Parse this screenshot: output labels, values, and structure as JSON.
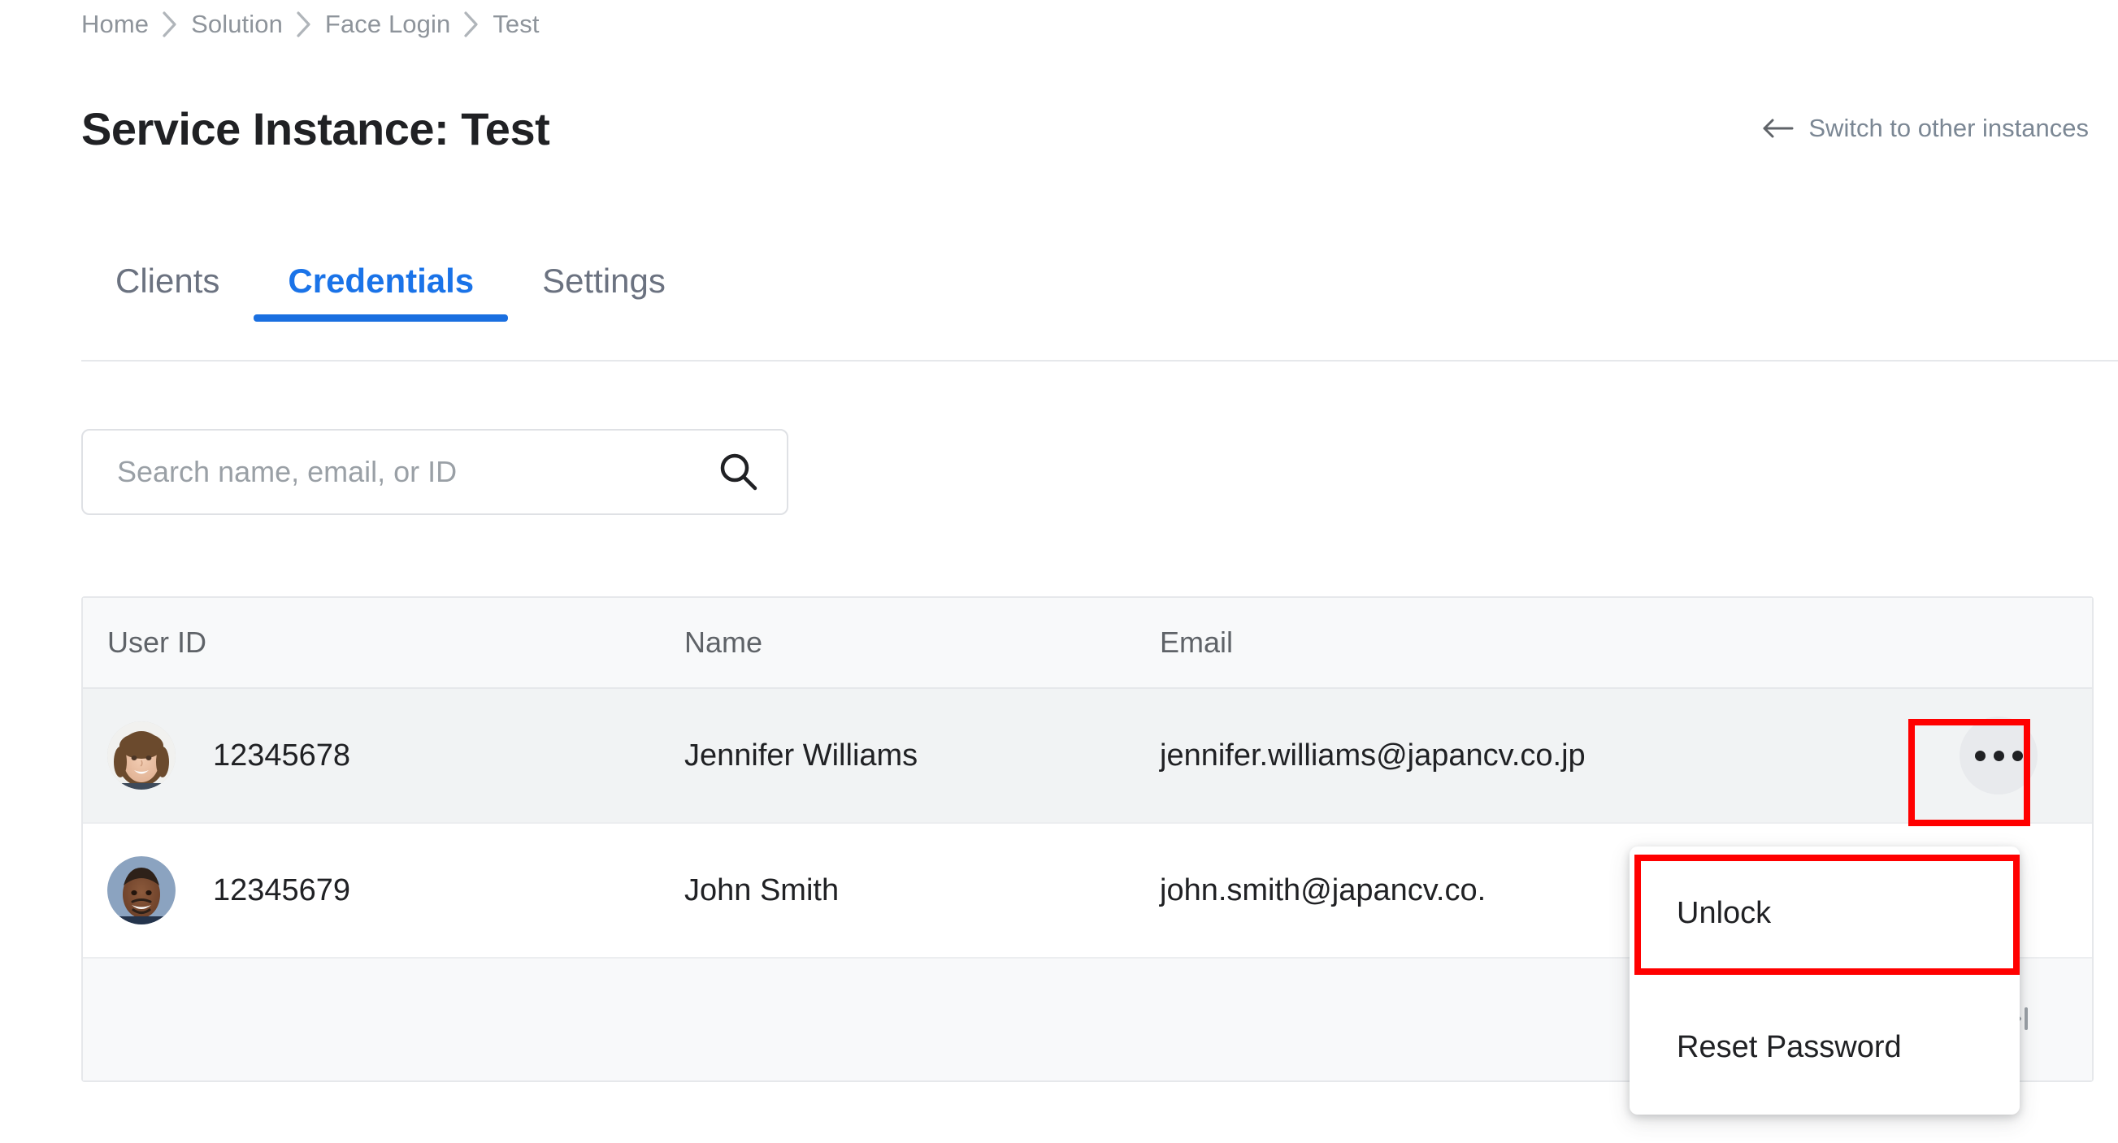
{
  "breadcrumb": {
    "items": [
      {
        "label": "Home"
      },
      {
        "label": "Solution"
      },
      {
        "label": "Face Login"
      },
      {
        "label": "Test"
      }
    ],
    "separator_icon": "chevron-right-icon"
  },
  "header": {
    "title": "Service Instance: Test",
    "switch_link": {
      "label": "Switch to other instances",
      "icon": "arrow-left-icon"
    }
  },
  "tabs": [
    {
      "label": "Clients",
      "active": false
    },
    {
      "label": "Credentials",
      "active": true
    },
    {
      "label": "Settings",
      "active": false
    }
  ],
  "search": {
    "placeholder": "Search name, email, or ID",
    "value": "",
    "icon": "search-icon"
  },
  "table": {
    "columns": [
      "User ID",
      "Name",
      "Email"
    ],
    "rows": [
      {
        "user_id": "12345678",
        "name": "Jennifer Williams",
        "email": "jennifer.williams@japancv.co.jp",
        "avatar": "avatar-woman",
        "action_icon": "kebab-menu-icon"
      },
      {
        "user_id": "12345679",
        "name": "John Smith",
        "email": "john.smith@japancv.co.",
        "avatar": "avatar-man",
        "action_icon": "kebab-menu-icon"
      }
    ],
    "pagination": {
      "first_label": "|<",
      "last_label": ">|",
      "first_icon": "page-first-icon",
      "last_icon": "page-last-icon"
    }
  },
  "context_menu": {
    "items": [
      {
        "label": "Unlock",
        "highlighted": true
      },
      {
        "label": "Reset Password",
        "highlighted": false
      }
    ]
  },
  "colors": {
    "accent": "#1a73e8",
    "tab_underline": "#1a6fe0",
    "text_primary": "#202124",
    "text_muted": "#9aa0a6",
    "row_hover": "#f1f3f4",
    "header_bg": "#f8f9fa",
    "border": "#e6e8eb",
    "annotation": "#ff0000"
  }
}
